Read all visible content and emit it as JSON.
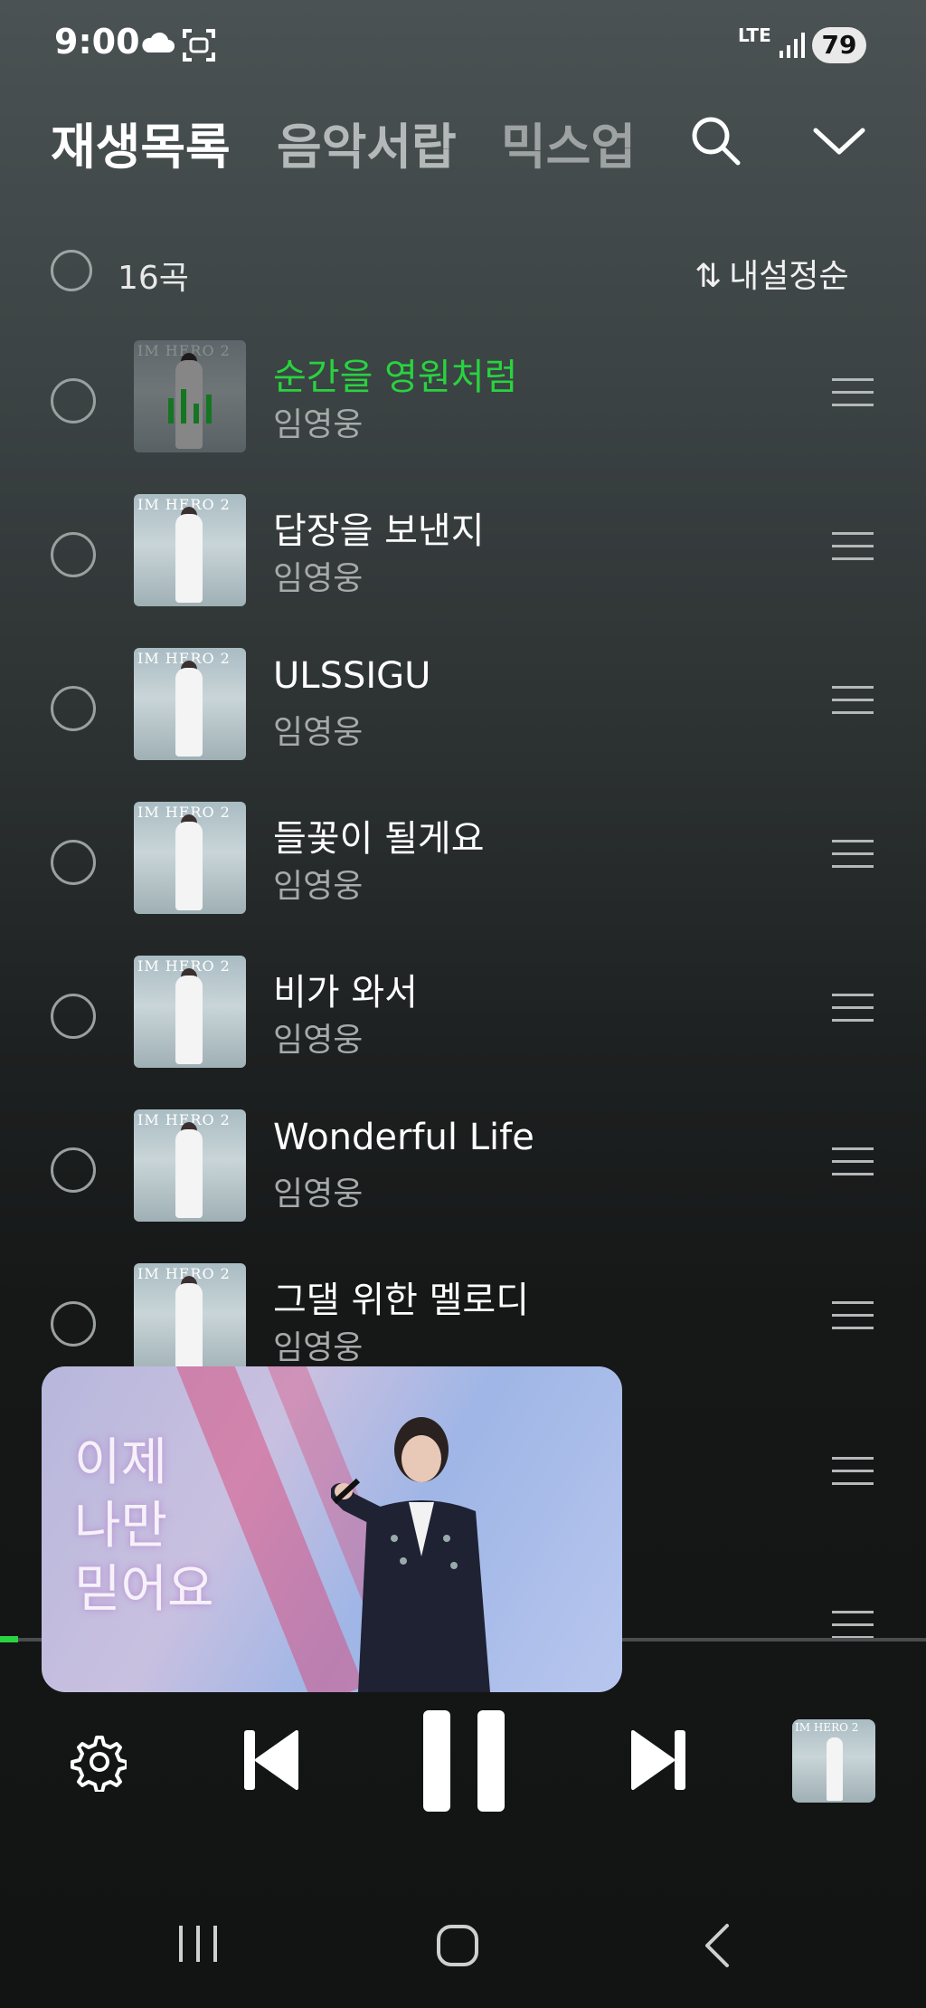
{
  "status_bar": {
    "time": "9:00",
    "network": "LTE",
    "battery": "79",
    "icons": [
      "cloud-icon",
      "screenshot-icon",
      "signal-icon"
    ]
  },
  "tabs": [
    {
      "label": "재생목록",
      "active": true
    },
    {
      "label": "음악서랍",
      "active": false
    },
    {
      "label": "믹스업",
      "active": false
    }
  ],
  "list_header": {
    "count": "16곡",
    "sort": "내설정순",
    "sort_icon": "⇅"
  },
  "songs": [
    {
      "title": "순간을 영원처럼",
      "artist": "임영웅",
      "playing": true
    },
    {
      "title": "답장을 보낸지",
      "artist": "임영웅",
      "playing": false
    },
    {
      "title": "ULSSIGU",
      "artist": "임영웅",
      "playing": false
    },
    {
      "title": "들꽃이 될게요",
      "artist": "임영웅",
      "playing": false
    },
    {
      "title": "비가 와서",
      "artist": "임영웅",
      "playing": false
    },
    {
      "title": "Wonderful Life",
      "artist": "임영웅",
      "playing": false
    },
    {
      "title": "그댈 위한 멜로디",
      "artist": "임영웅",
      "playing": false
    }
  ],
  "album_art_text": "IM HERO 2",
  "video_overlay": {
    "text": "이제\n나만\n믿어요"
  },
  "player": {
    "progress": 0.02,
    "accent_color": "#28d33f"
  }
}
